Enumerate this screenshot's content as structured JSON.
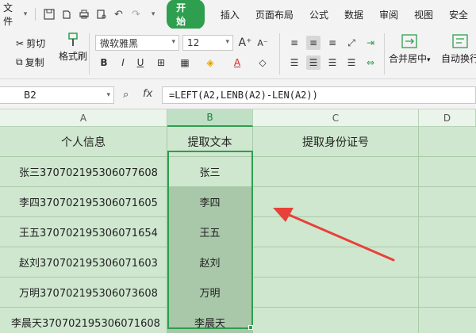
{
  "menu": {
    "file_label": "文件",
    "tabs": [
      "开始",
      "插入",
      "页面布局",
      "公式",
      "数据",
      "审阅",
      "视图",
      "安全"
    ]
  },
  "ribbon": {
    "cut_label": "剪切",
    "copy_label": "复制",
    "format_painter_label": "格式刷",
    "font_name": "微软雅黑",
    "font_size": "12",
    "merge_label": "合并居中",
    "wrap_label": "自动换行"
  },
  "formula_bar": {
    "cell_ref": "B2",
    "formula": "=LEFT(A2,LENB(A2)-LEN(A2))"
  },
  "sheet": {
    "columns": [
      "A",
      "B",
      "C",
      "D"
    ],
    "headers": [
      "个人信息",
      "提取文本",
      "提取身份证号"
    ],
    "rows": [
      {
        "a": "张三370702195306077608",
        "b": "张三"
      },
      {
        "a": "李四370702195306071605",
        "b": "李四"
      },
      {
        "a": "王五370702195306071654",
        "b": "王五"
      },
      {
        "a": "赵刘370702195306071603",
        "b": "赵刘"
      },
      {
        "a": "万明370702195306073608",
        "b": "万明"
      },
      {
        "a": "李晨天370702195306071608",
        "b": "李晨天"
      }
    ]
  },
  "colors": {
    "accent": "#2e9e4f",
    "cell_bg": "#cfe7cf",
    "selected_bg": "#a9c7a9",
    "annotation_arrow": "#e8413a"
  }
}
